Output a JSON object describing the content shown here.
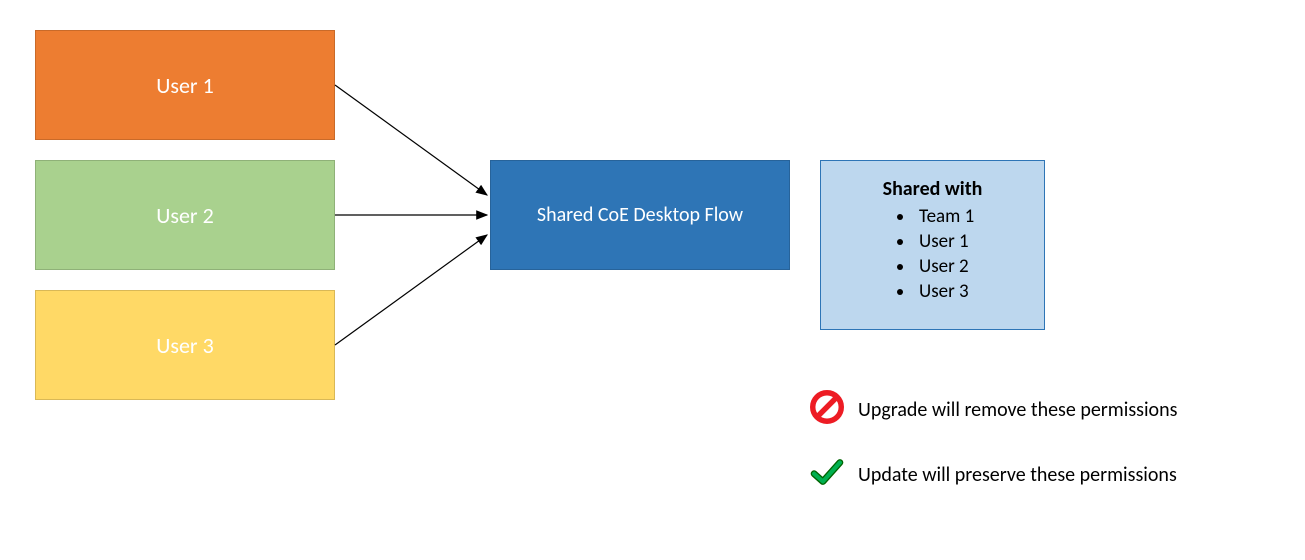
{
  "users": {
    "user1": {
      "label": "User 1",
      "fill": "#ED7D31"
    },
    "user2": {
      "label": "User 2",
      "fill": "#A9D18E"
    },
    "user3": {
      "label": "User 3",
      "fill": "#FFD966"
    }
  },
  "flow": {
    "label": "Shared CoE Desktop Flow",
    "fill": "#2E75B6"
  },
  "shared_with": {
    "title": "Shared with",
    "items": [
      "Team 1",
      "User 1",
      "User 2",
      "User 3"
    ],
    "fill": "#BDD7EE",
    "stroke": "#2E75B6"
  },
  "legend": {
    "upgrade": "Upgrade will remove these permissions",
    "update": "Update will preserve these permissions"
  },
  "colors": {
    "arrow": "#000000",
    "prohibit": "#ED1C24",
    "check_fill": "#00B050",
    "check_stroke": "#006400"
  }
}
